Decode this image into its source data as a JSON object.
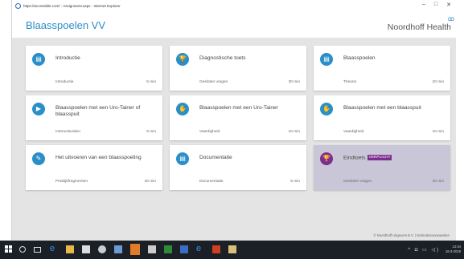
{
  "browser": {
    "title": "https://accessible.com/ - Assignment.aspx - Internet Explorer",
    "controls": [
      "–",
      "□",
      "✕"
    ]
  },
  "header": {
    "title": "Blaasspoelen VV",
    "brand": "Noordhoff Health"
  },
  "cards": [
    {
      "title": "Introductie",
      "type": "Introductie",
      "duration": "5 min",
      "icon": "document-icon",
      "glyph": "▤"
    },
    {
      "title": "Diagnostische toets",
      "type": "Gesloten vragen",
      "duration": "30 min",
      "icon": "trophy-icon",
      "glyph": "🏆"
    },
    {
      "title": "Blaasspoelen",
      "type": "Theorie",
      "duration": "20 min",
      "icon": "document-icon",
      "glyph": "▤"
    },
    {
      "title": "Blaasspoelen met een Uro-Tainer of blaasspuit",
      "type": "Instructievideo",
      "duration": "5 min",
      "icon": "video-icon",
      "glyph": "▶"
    },
    {
      "title": "Blaasspoelen met een Uro-Tainer",
      "type": "Vaardigheid",
      "duration": "10 min",
      "icon": "hand-icon",
      "glyph": "✋"
    },
    {
      "title": "Blaasspoelen met een blaasspuit",
      "type": "Vaardigheid",
      "duration": "10 min",
      "icon": "hand-icon",
      "glyph": "✋"
    },
    {
      "title": "Het uitvoeren van een blaasspoeling",
      "type": "Praktijkfragmenten",
      "duration": "30 min",
      "icon": "pencil-icon",
      "glyph": "✎"
    },
    {
      "title": "Documentatie",
      "type": "Documentatie",
      "duration": "5 min",
      "icon": "document-icon",
      "glyph": "▤"
    },
    {
      "title": "Eindtoets",
      "badge": "VERPLICHT",
      "type": "Gesloten vragen",
      "duration": "40 min",
      "icon": "trophy-icon",
      "glyph": "🏆"
    }
  ],
  "footer": "© Noordhoff Uitgevers B.V. | Gebruiksvoorwaarden",
  "taskbar": {
    "tray": "^ ◘ ▭ ◁)",
    "clock_time": "12:44",
    "clock_date": "18-3-2019"
  },
  "colors": {
    "accent": "#2a8fc6",
    "exam": "#7d2d8f",
    "exam_card": "#c9c7d7"
  }
}
